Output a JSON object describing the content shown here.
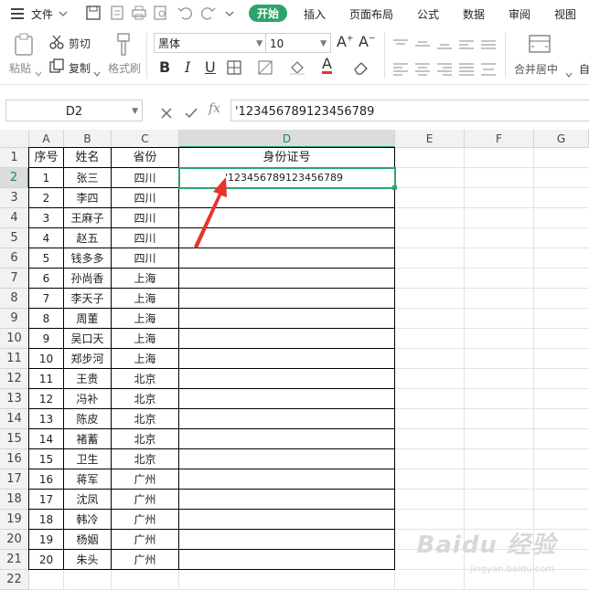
{
  "menu": {
    "file_label": "文件",
    "tabs": [
      "开始",
      "插入",
      "页面布局",
      "公式",
      "数据",
      "审阅",
      "视图"
    ]
  },
  "ribbon": {
    "paste_label": "粘贴",
    "cut_label": "剪切",
    "copy_label": "复制",
    "format_painter_label": "格式刷",
    "font_name": "黑体",
    "font_size": "10",
    "merge_label": "合并居中",
    "auto_label": "自"
  },
  "formula_bar": {
    "cell_ref": "D2",
    "fx_label": "fx",
    "value": "'123456789123456789"
  },
  "columns": [
    "A",
    "B",
    "C",
    "D",
    "E",
    "F",
    "G"
  ],
  "rows": [
    "1",
    "2",
    "3",
    "4",
    "5",
    "6",
    "7",
    "8",
    "9",
    "10",
    "11",
    "12",
    "13",
    "14",
    "15",
    "16",
    "17",
    "18",
    "19",
    "20",
    "21",
    "22"
  ],
  "table": {
    "headers": [
      "序号",
      "姓名",
      "省份",
      "身份证号"
    ],
    "d2_value": "'123456789123456789",
    "data": [
      [
        "1",
        "张三",
        "四川"
      ],
      [
        "2",
        "李四",
        "四川"
      ],
      [
        "3",
        "王麻子",
        "四川"
      ],
      [
        "4",
        "赵五",
        "四川"
      ],
      [
        "5",
        "钱多多",
        "四川"
      ],
      [
        "6",
        "孙尚香",
        "上海"
      ],
      [
        "7",
        "李天子",
        "上海"
      ],
      [
        "8",
        "周董",
        "上海"
      ],
      [
        "9",
        "吴口天",
        "上海"
      ],
      [
        "10",
        "郑步河",
        "上海"
      ],
      [
        "11",
        "王贵",
        "北京"
      ],
      [
        "12",
        "冯补",
        "北京"
      ],
      [
        "13",
        "陈皮",
        "北京"
      ],
      [
        "14",
        "褚蓄",
        "北京"
      ],
      [
        "15",
        "卫生",
        "北京"
      ],
      [
        "16",
        "蒋军",
        "广州"
      ],
      [
        "17",
        "沈凤",
        "广州"
      ],
      [
        "18",
        "韩冷",
        "广州"
      ],
      [
        "19",
        "杨姻",
        "广州"
      ],
      [
        "20",
        "朱头",
        "广州"
      ]
    ]
  },
  "watermark": {
    "text": "Baidu 经验",
    "sub": "jingyan.baidu.com"
  },
  "colors": {
    "accent": "#2da36b",
    "arrow": "#e8332a"
  }
}
